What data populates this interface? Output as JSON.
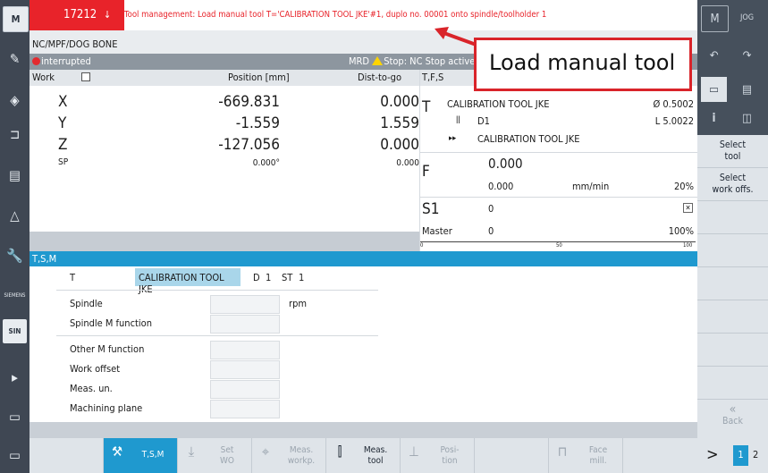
{
  "alarm": {
    "number": "17212",
    "arrow": "↓",
    "message": "Tool management: Load manual tool T='CALIBRATION TOOL JKE'#1, duplo no. 00001 onto spindle/toolholder 1"
  },
  "program": {
    "path": "NC/MPF/DOG BONE",
    "status": "interrupted",
    "channel_status": "MRD",
    "stop_text": "Stop: NC Stop active"
  },
  "positions": {
    "header": {
      "work": "Work",
      "position": "Position [mm]",
      "dist": "Dist-to-go",
      "tfs": "T,F,S"
    },
    "axes": [
      {
        "name": "X",
        "value": "-669.831",
        "dist": "0.000"
      },
      {
        "name": "Y",
        "value": "-1.559",
        "dist": "1.559"
      },
      {
        "name": "Z",
        "value": "-127.056",
        "dist": "0.000"
      }
    ],
    "sp": {
      "name": "SP",
      "value": "0.000°",
      "dist": "0.000"
    }
  },
  "tool": {
    "letter": "T",
    "name": "CALIBRATION TOOL JKE",
    "diameter": "Ø 0.5002",
    "d_label": "D1",
    "length": "L 5.0022",
    "next_tool": "CALIBRATION TOOL JKE"
  },
  "feed": {
    "letter": "F",
    "value": "0.000",
    "actual": "0.000",
    "unit": "mm/min",
    "override": "20%"
  },
  "spindle": {
    "label": "S1",
    "value": "0",
    "master_label": "Master",
    "master_value": "0",
    "override": "100%",
    "scale_min": "0",
    "scale_mid": "50",
    "scale_max": "100"
  },
  "tsm": {
    "title": "T,S,M",
    "t_label": "T",
    "t_value": "CALIBRATION TOOL JKE",
    "d_label": "D",
    "d_value": "1",
    "st_label": "ST",
    "st_value": "1",
    "rows": [
      {
        "label": "Spindle",
        "unit": "rpm"
      },
      {
        "label": "Spindle M function",
        "unit": ""
      },
      {
        "label": "Other M function",
        "unit": ""
      },
      {
        "label": "Work offset",
        "unit": ""
      },
      {
        "label": "Meas. un.",
        "unit": ""
      },
      {
        "label": "Machining plane",
        "unit": ""
      }
    ]
  },
  "right_softkeys": {
    "select_tool": "Select\ntool",
    "select_work_offs": "Select\nwork offs.",
    "back": "Back",
    "back_icon": "«"
  },
  "bottom_softkeys": [
    {
      "label": "T,S,M",
      "icon": "tool-spindle-icon"
    },
    {
      "label": "Set\nWO",
      "icon": "set-wo-icon"
    },
    {
      "label": "Meas.\nworkp.",
      "icon": "measure-workpiece-icon"
    },
    {
      "label": "Meas.\ntool",
      "icon": "measure-tool-icon"
    },
    {
      "label": "Posi-\ntion",
      "icon": "position-icon"
    },
    {
      "label": "Face\nmill.",
      "icon": "face-mill-icon"
    }
  ],
  "bottom_right": {
    "arrow": ">",
    "page1": "1",
    "page2": "2"
  },
  "callout": {
    "text": "Load manual tool"
  },
  "colors": {
    "alarm_red": "#e8232a",
    "accent_blue": "#1f99cf",
    "panel_gray": "#46505c"
  }
}
